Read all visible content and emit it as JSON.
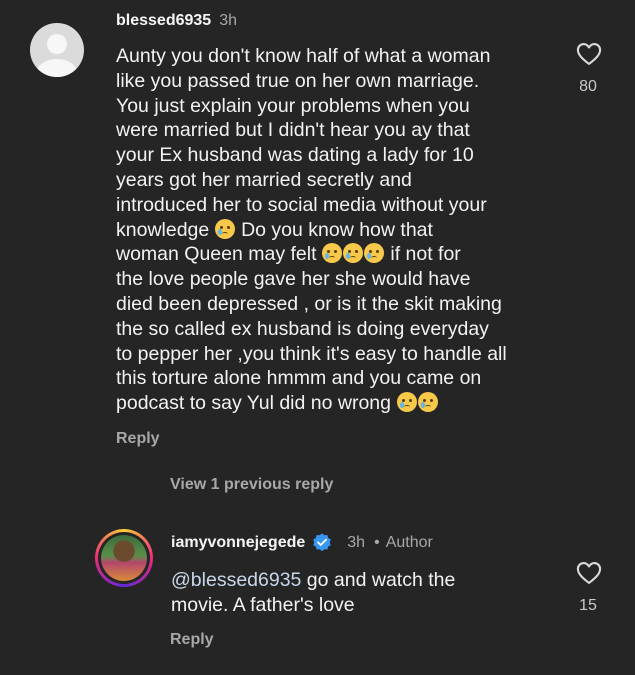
{
  "comment1": {
    "username": "blessed6935",
    "time": "3h",
    "lines": [
      "Aunty you don't know half of what a woman",
      "like you passed true on her own marriage.",
      "You just explain your problems when you",
      "were married but I didn't hear you ay that",
      "your Ex husband  was dating a lady for 10",
      "years got her married secretly and",
      "introduced her to social media without your"
    ],
    "line8_text": "knowledge",
    "line8_after": " Do you know how that",
    "line9_text": "woman Queen may felt",
    "line9_after": " if not for",
    "lines_tail": [
      "the love people gave her she would have",
      "died been depressed , or is it the skit making",
      "the so called ex husband is doing everyday",
      "to pepper her ,you think it's easy to handle all",
      "this torture alone hmmm and you came on"
    ],
    "last_line": "podcast to say Yul did no wrong",
    "emoji_name": "crying-face",
    "likes": "80",
    "reply_label": "Reply"
  },
  "view_previous_label": "View 1 previous reply",
  "comment2": {
    "username": "iamyvonnejegede",
    "time": "3h",
    "separator": "•",
    "author_label": "Author",
    "mention": "@blessed6935",
    "text_line1": " go and watch the",
    "text_line2": "movie. A father's love",
    "likes": "15",
    "reply_label": "Reply"
  },
  "colors": {
    "background": "#252525",
    "secondary_text": "#a8a8a8",
    "verified_badge": "#3897f0"
  }
}
